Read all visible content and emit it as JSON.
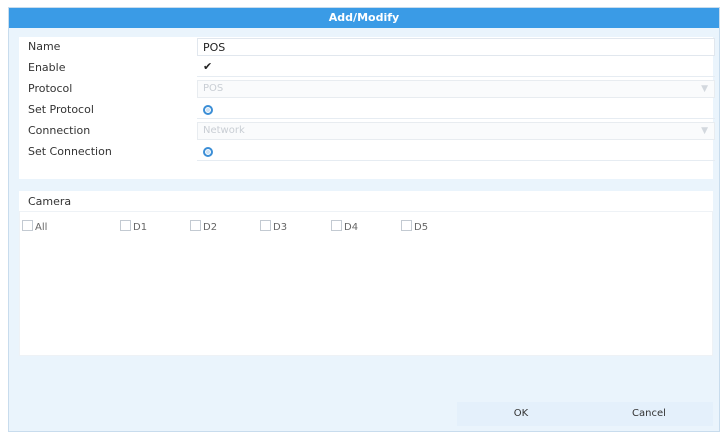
{
  "dialog": {
    "title": "Add/Modify"
  },
  "form": {
    "name_label": "Name",
    "name_value": "POS",
    "enable_label": "Enable",
    "enable_checked": true,
    "enable_mark": "✔",
    "protocol_label": "Protocol",
    "protocol_value": "POS",
    "set_protocol_label": "Set Protocol",
    "connection_label": "Connection",
    "connection_value": "Network",
    "set_connection_label": "Set Connection"
  },
  "camera": {
    "title": "Camera",
    "items": [
      "All",
      "D1",
      "D2",
      "D3",
      "D4",
      "D5"
    ]
  },
  "buttons": {
    "ok": "OK",
    "cancel": "Cancel"
  },
  "colors": {
    "title_bar": "#3a9be6",
    "dialog_bg": "#eaf4fc",
    "accent": "#3b8ed6"
  },
  "icons": {
    "dropdown": "chevron-down-icon",
    "setup": "gear-icon"
  }
}
